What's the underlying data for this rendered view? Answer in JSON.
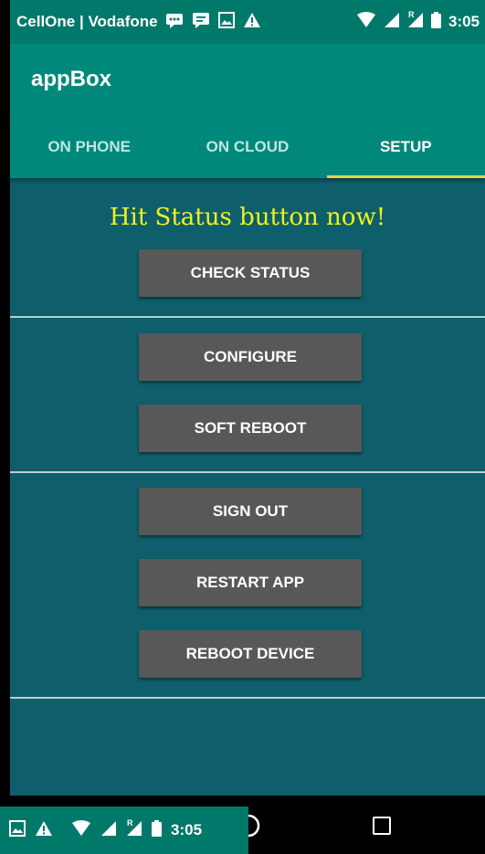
{
  "status_bar": {
    "carrier": "CellOne | Vodafone",
    "time": "3:05",
    "icons": [
      "message-icon",
      "chat-icon",
      "image-icon",
      "warning-icon",
      "wifi-icon",
      "signal-icon",
      "roaming-signal-icon",
      "battery-icon"
    ],
    "roaming_mark": "R"
  },
  "app_bar": {
    "title": "appBox"
  },
  "tabs": [
    {
      "label": "ON PHONE",
      "active": false
    },
    {
      "label": "ON CLOUD",
      "active": false
    },
    {
      "label": "SETUP",
      "active": true
    }
  ],
  "setup": {
    "headline": "Hit Status button now!",
    "buttons": {
      "check_status": "CHECK STATUS",
      "configure": "CONFIGURE",
      "soft_reboot": "SOFT REBOOT",
      "sign_out": "SIGN OUT",
      "restart_app": "RESTART APP",
      "reboot_device": "REBOOT DEVICE"
    }
  },
  "overlay_status": {
    "time": "3:05",
    "roaming_mark": "R"
  },
  "nav_bar": {
    "icons": [
      "home-icon",
      "recent-apps-icon"
    ]
  },
  "colors": {
    "status_bar": "#00796b",
    "app_bar": "#00897b",
    "content_bg": "#0e5f6b",
    "button_bg": "#595859",
    "headline": "#f2f21a",
    "tab_indicator": "#e8d44d"
  }
}
